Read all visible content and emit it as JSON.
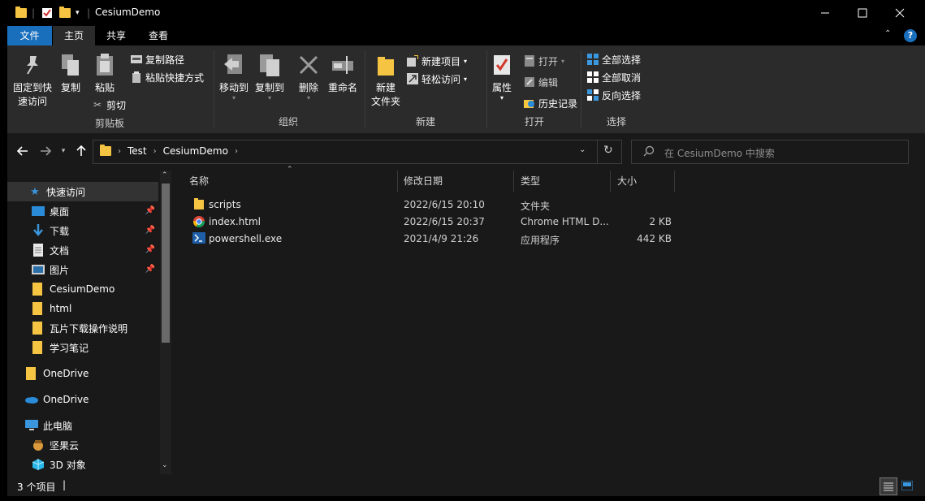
{
  "window": {
    "title": "CesiumDemo"
  },
  "tabs": [
    {
      "label": "文件"
    },
    {
      "label": "主页"
    },
    {
      "label": "共享"
    },
    {
      "label": "查看"
    }
  ],
  "ribbon": {
    "clipboard": {
      "label": "剪贴板",
      "pin_line1": "固定到快",
      "pin_line2": "速访问",
      "copy": "复制",
      "paste": "粘贴",
      "copy_path": "复制路径",
      "paste_shortcut": "粘贴快捷方式",
      "cut": "剪切"
    },
    "organize": {
      "label": "组织",
      "move_to": "移动到",
      "copy_to": "复制到",
      "delete": "删除",
      "rename": "重命名"
    },
    "new": {
      "label": "新建",
      "new_folder_line1": "新建",
      "new_folder_line2": "文件夹",
      "new_item": "新建项目",
      "easy_access": "轻松访问"
    },
    "open": {
      "label": "打开",
      "properties": "属性",
      "open": "打开",
      "edit": "编辑",
      "history": "历史记录"
    },
    "select": {
      "label": "选择",
      "select_all": "全部选择",
      "select_none": "全部取消",
      "invert": "反向选择"
    }
  },
  "address": {
    "crumbs": [
      "Test",
      "CesiumDemo"
    ],
    "search_placeholder": "在 CesiumDemo 中搜索"
  },
  "nav": {
    "quick_access": "快速访问",
    "items": [
      {
        "label": "桌面",
        "pinned": true
      },
      {
        "label": "下载",
        "pinned": true
      },
      {
        "label": "文档",
        "pinned": true
      },
      {
        "label": "图片",
        "pinned": true
      },
      {
        "label": "CesiumDemo"
      },
      {
        "label": "html"
      },
      {
        "label": "瓦片下载操作说明"
      },
      {
        "label": "学习笔记"
      }
    ],
    "onedrive1": "OneDrive",
    "onedrive2": "OneDrive",
    "this_pc": "此电脑",
    "jianguoyun": "坚果云",
    "objects3d": "3D 对象"
  },
  "columns": {
    "name": "名称",
    "modified": "修改日期",
    "type": "类型",
    "size": "大小"
  },
  "files": [
    {
      "name": "scripts",
      "modified": "2022/6/15 20:10",
      "type": "文件夹",
      "size": "",
      "icon": "folder-icon"
    },
    {
      "name": "index.html",
      "modified": "2022/6/15 20:37",
      "type": "Chrome HTML D...",
      "size": "2 KB",
      "icon": "chrome-icon"
    },
    {
      "name": "powershell.exe",
      "modified": "2021/4/9 21:26",
      "type": "应用程序",
      "size": "442 KB",
      "icon": "powershell-icon"
    }
  ],
  "status": {
    "count": "3 个项目"
  },
  "colors": {
    "accent": "#1a6fbd",
    "folder": "#f5c443",
    "background": "#191919"
  }
}
